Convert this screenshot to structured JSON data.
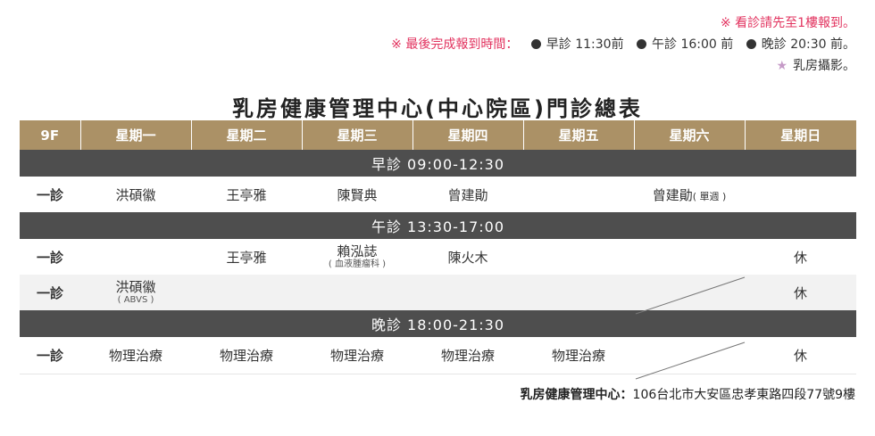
{
  "notes": {
    "line1": "※ 看診請先至1樓報到。",
    "line2_lead": "※ 最後完成報到時間：",
    "times": [
      "早診 11:30前",
      "午診 16:00 前",
      "晚診 20:30 前。"
    ],
    "line3": "乳房攝影。",
    "star": "★"
  },
  "title": "乳房健康管理中心(中心院區)門診總表",
  "header": [
    "9F",
    "星期一",
    "星期二",
    "星期三",
    "星期四",
    "星期五",
    "星期六",
    "星期日"
  ],
  "sessions": {
    "morning": "早診  09:00-12:30",
    "afternoon": "午診  13:30-17:00",
    "evening": "晚診  18:00-21:30"
  },
  "rows": {
    "morning1": {
      "label": "一診",
      "mon": "洪碩徽",
      "tue": "王亭雅",
      "wed": "陳賢典",
      "thu": "曾建勛",
      "fri": "",
      "sat": "曾建勛",
      "sat_note": "( 單週 )",
      "sun": ""
    },
    "afternoon1": {
      "label": "一診",
      "mon": "",
      "tue": "王亭雅",
      "wed": "賴泓誌",
      "wed_note": "( 血液腫瘤科 )",
      "thu": "陳火木",
      "fri": "",
      "sat": "",
      "sun": "休"
    },
    "afternoon2": {
      "label": "一診",
      "mon": "洪碩徽",
      "mon_note": "( ABVS )",
      "tue": "",
      "wed": "",
      "thu": "",
      "fri": "",
      "sat": "",
      "sun": "休"
    },
    "evening1": {
      "label": "一診",
      "mon": "物理治療",
      "tue": "物理治療",
      "wed": "物理治療",
      "thu": "物理治療",
      "fri": "物理治療",
      "sat": "",
      "sun": "休"
    }
  },
  "footer": {
    "name": "乳房健康管理中心：",
    "address": "106台北市大安區忠孝東路四段77號9樓"
  },
  "colors": {
    "header_bg": "#ab9166",
    "session_bg": "#4e4e4e",
    "note_red": "#e2335f",
    "star": "#c59ac7"
  }
}
